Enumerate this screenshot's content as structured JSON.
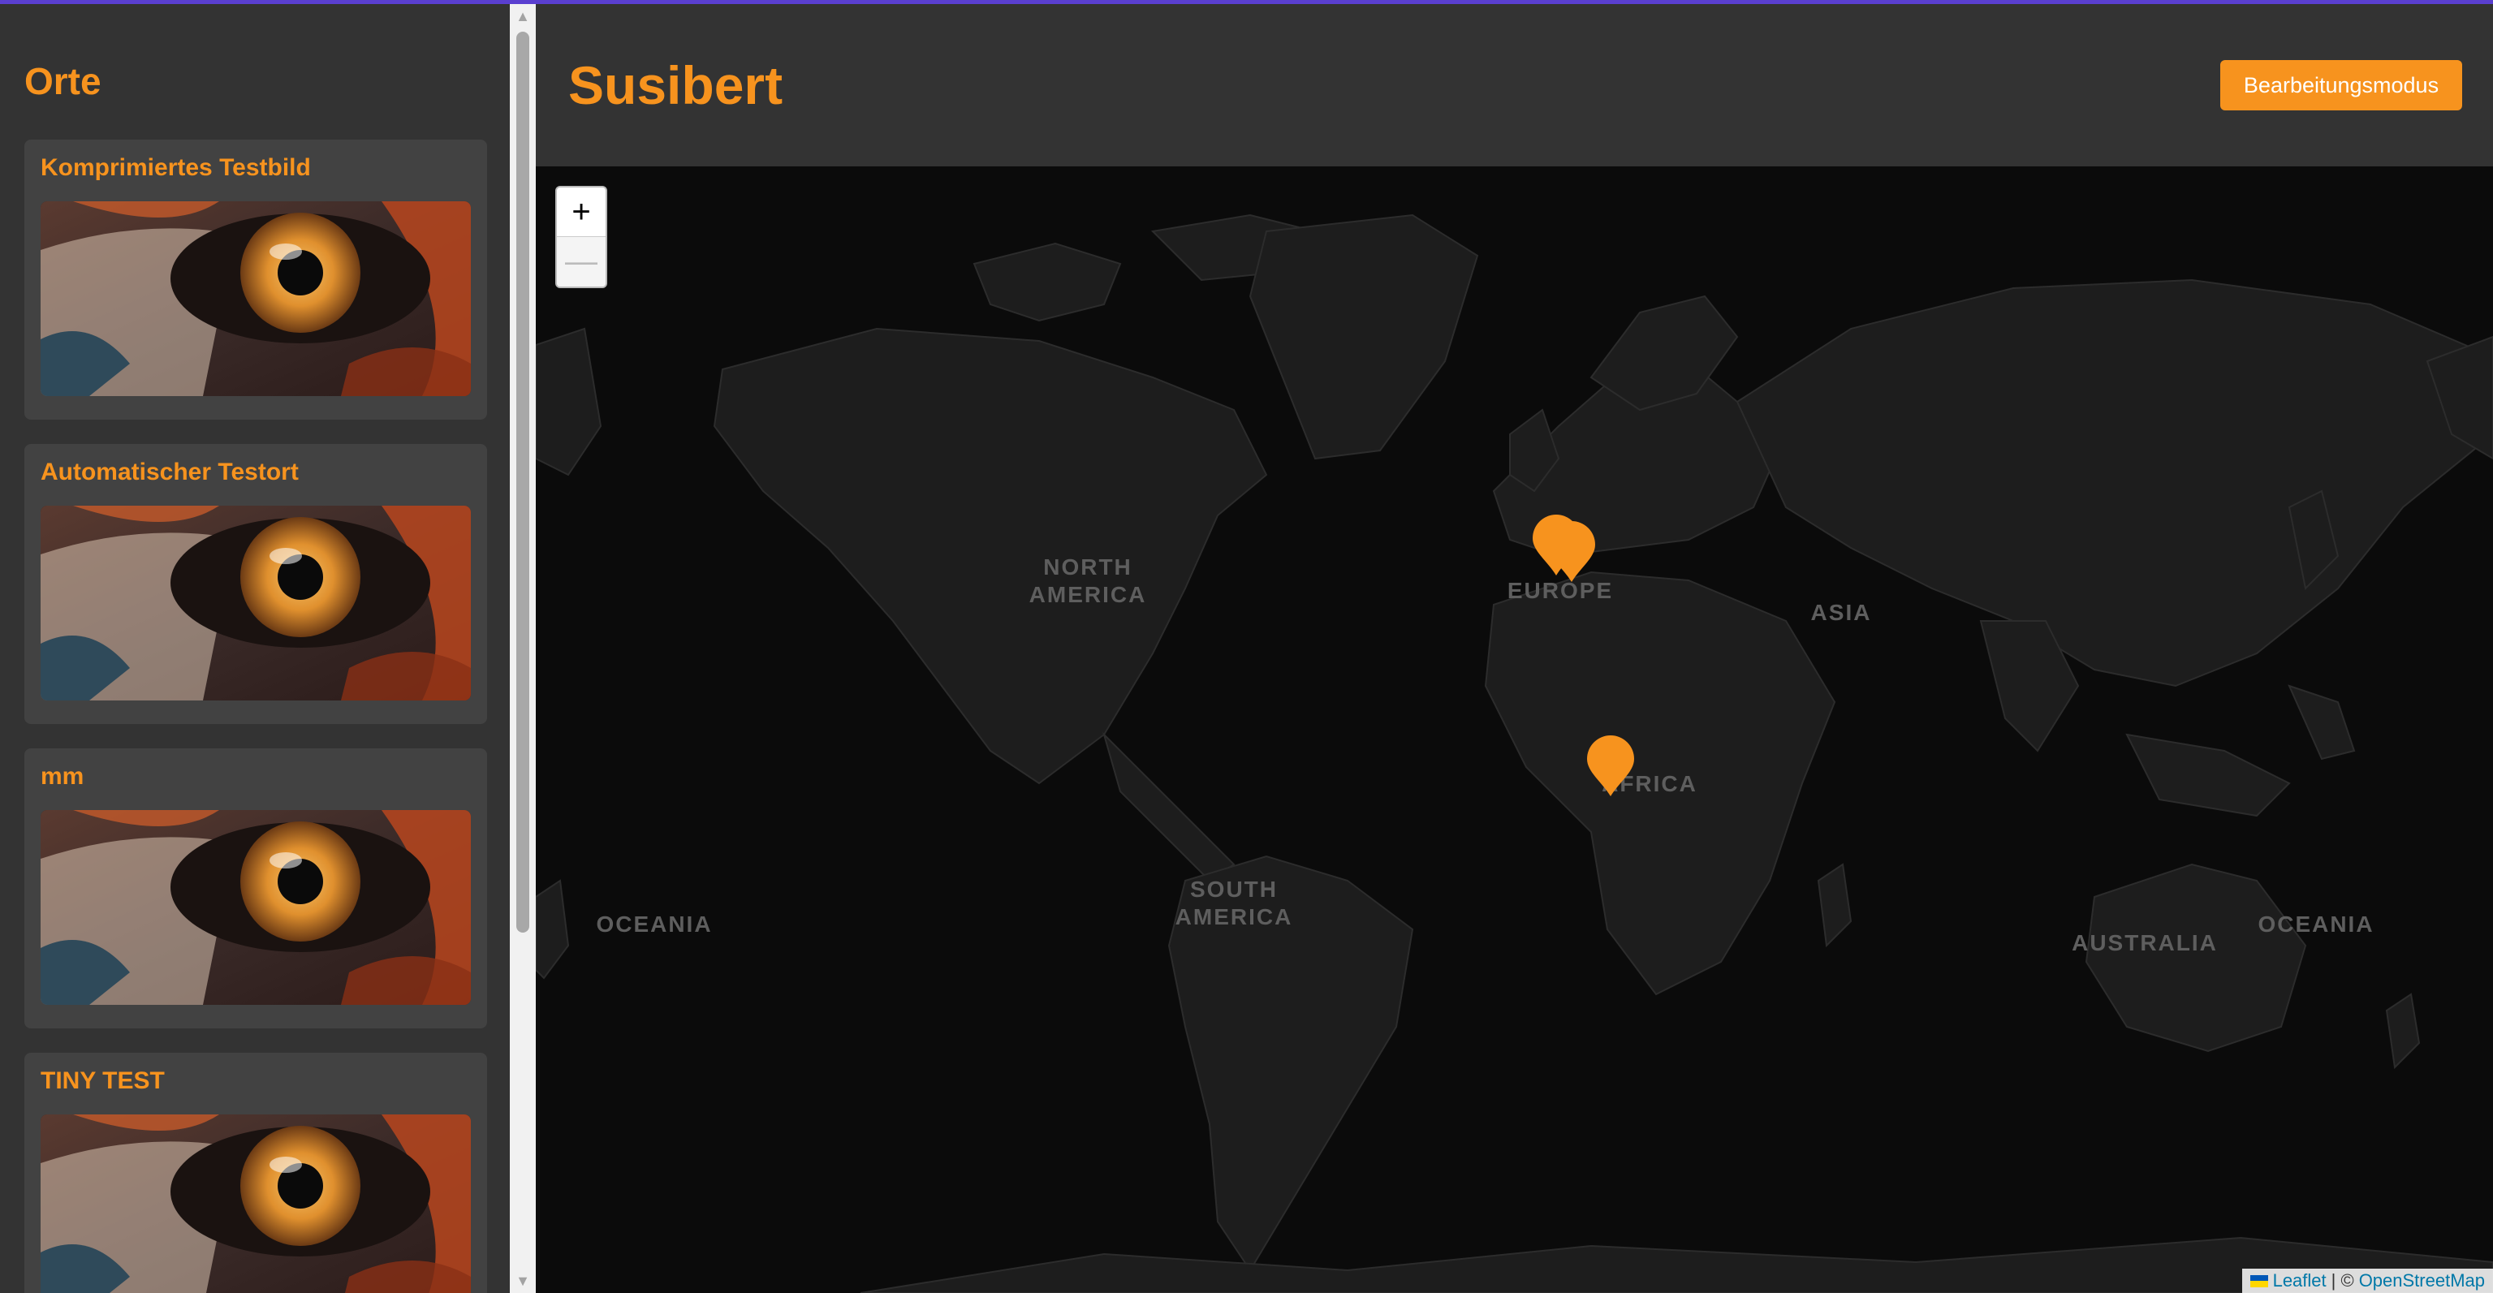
{
  "sidebar": {
    "title": "Orte",
    "places": [
      {
        "title": "Komprimiertes Testbild"
      },
      {
        "title": "Automatischer Testort"
      },
      {
        "title": "mm"
      },
      {
        "title": "TINY TEST"
      }
    ]
  },
  "header": {
    "title": "Susibert",
    "edit_button_label": "Bearbeitungsmodus"
  },
  "map": {
    "zoom_in_label": "+",
    "zoom_out_label": "—",
    "continent_labels": {
      "north_america_1": "NORTH",
      "north_america_2": "AMERICA",
      "south_america_1": "SOUTH",
      "south_america_2": "AMERICA",
      "europe": "EUROPE",
      "asia": "ASIA",
      "africa": "AFRICA",
      "australia": "AUSTRALIA",
      "oceania_left": "OCEANIA",
      "oceania_right": "OCEANIA"
    },
    "marker_count": 3,
    "attribution": {
      "leaflet": "Leaflet",
      "separator": "| ©",
      "osm": "OpenStreetMap"
    }
  },
  "colors": {
    "accent": "#f7931e",
    "background": "#333333",
    "card": "#424242",
    "map": "#0b0b0b",
    "land": "#1d1d1d"
  },
  "icons": [
    "map-marker-icon",
    "scroll-up-arrow-icon",
    "scroll-down-arrow-icon",
    "ukraine-flag-icon"
  ]
}
